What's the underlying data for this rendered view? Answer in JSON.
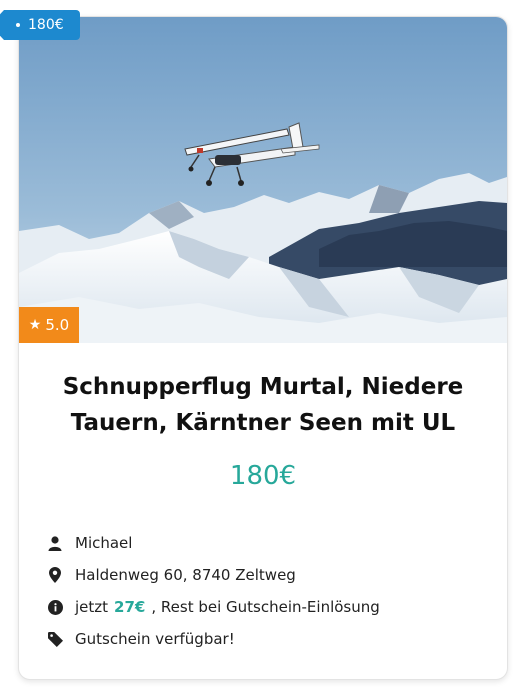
{
  "badge": {
    "price": "180€"
  },
  "rating": {
    "value": "5.0",
    "icon": "star-icon"
  },
  "title": "Schnupperflug Murtal, Niedere Tauern, Kärntner Seen mit UL",
  "price": "180€",
  "details": {
    "host": "Michael",
    "address": "Haldenweg 60, 8740 Zeltweg",
    "deposit_prefix": "jetzt",
    "deposit_amount": "27€",
    "deposit_suffix": ", Rest bei Gutschein-Einlösung",
    "voucher": "Gutschein verfügbar!"
  },
  "colors": {
    "badge": "#1d89cf",
    "rating": "#f28a1a",
    "accent": "#27a89a"
  }
}
